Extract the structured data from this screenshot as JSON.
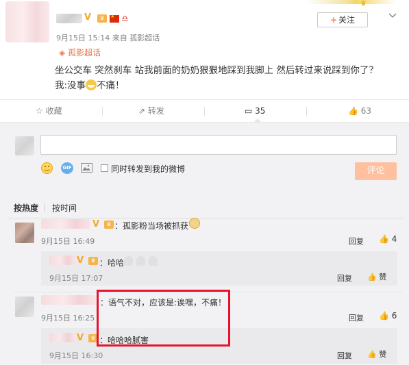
{
  "post": {
    "follow_label": "关注",
    "follow_plus": "+",
    "time": "9月15日 15:14",
    "source_prefix": "来自",
    "source": "孤影超话",
    "topic": "孤影超话",
    "text_line1": "坐公交车 突然刹车 站我前面的奶奶狠狠地踩到我脚上 然后转过来说踩到你了？",
    "text_line2_prefix": "我:没事",
    "text_line2_suffix": "不痛！",
    "actions": {
      "favorite": "收藏",
      "repost": "转发",
      "comment_count": "35",
      "like_count": "63"
    }
  },
  "composer": {
    "repost_checkbox_label": "同时转发到我的微博",
    "submit_label": "评论",
    "gif_label": "GIF"
  },
  "sort": {
    "by_hot": "按热度",
    "by_time": "按时间"
  },
  "comments": [
    {
      "text": "：孤影粉当场被抓获",
      "time": "9月15日 16:49",
      "reply_label": "回复",
      "likes": "4",
      "replies": [
        {
          "text": "：哈哈",
          "time": "9月15日 17:07",
          "reply_label": "回复",
          "like_label": "赞"
        }
      ]
    },
    {
      "text": "：语气不对，应该是:诶嘿，不痛！",
      "time": "9月15日 16:25",
      "reply_label": "回复",
      "likes": "6",
      "replies": [
        {
          "text": "：哈哈哈腻害",
          "time": "9月15日 16:30",
          "reply_label": "回复",
          "like_label": "赞"
        }
      ]
    }
  ],
  "colors": {
    "accent_orange": "#eb7350",
    "submit_disabled": "#ffc09f",
    "highlight_red": "#e8122a",
    "verified_gold": "#f5a623"
  }
}
